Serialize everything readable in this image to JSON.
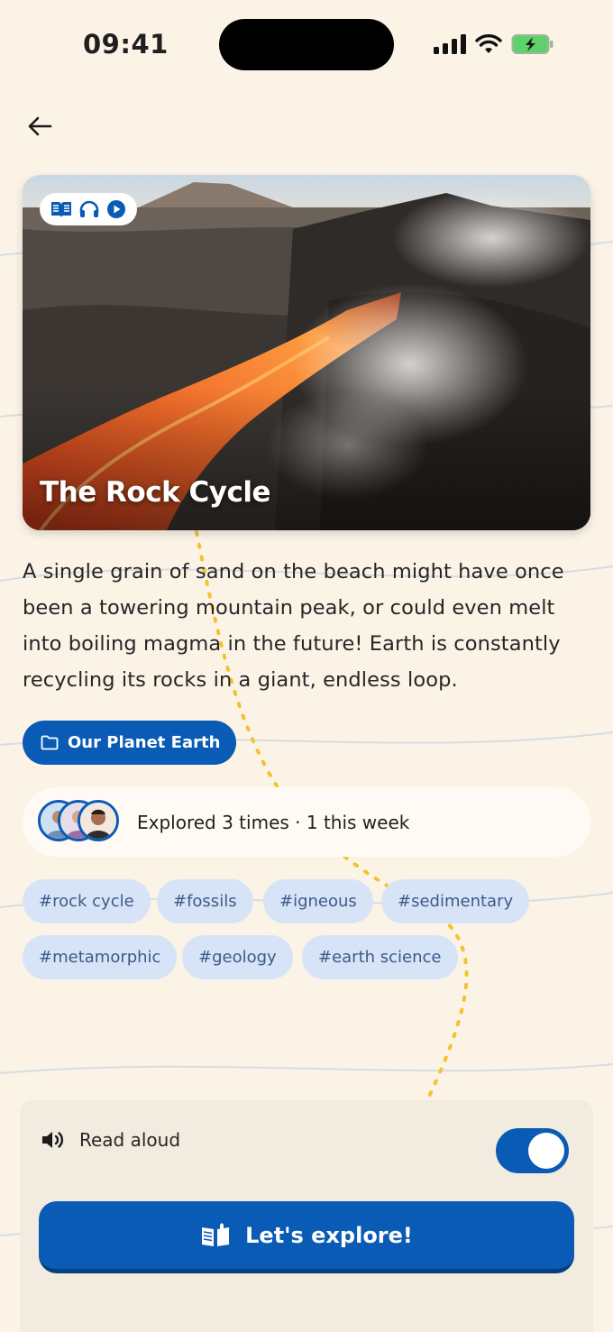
{
  "status_bar": {
    "time": "09:41"
  },
  "hero": {
    "title": "The Rock Cycle",
    "media_icons": [
      "book-open-icon",
      "headphones-icon",
      "play-circle-icon"
    ]
  },
  "description": "A single grain of sand on the beach might have once been a towering mountain peak, or could even melt into boiling magma in the future! Earth is constantly recycling its rocks in a giant, endless loop.",
  "collection": {
    "label": "Our Planet Earth",
    "icon": "folder-icon"
  },
  "explored": {
    "text": "Explored 3 times · 1 this week",
    "avatar_count": 3
  },
  "tags": [
    "#rock cycle",
    "#fossils",
    "#igneous",
    "#sedimentary",
    "#metamorphic",
    "#geology",
    "#earth science"
  ],
  "read_aloud": {
    "label": "Read aloud",
    "enabled": true
  },
  "cta": {
    "label": "Let's explore!"
  },
  "colors": {
    "primary": "#0a5bb5",
    "background": "#fbf3e6",
    "tag_bg": "#d7e4f8",
    "tag_text": "#3d5a86",
    "dotted_path": "#f3c232"
  }
}
